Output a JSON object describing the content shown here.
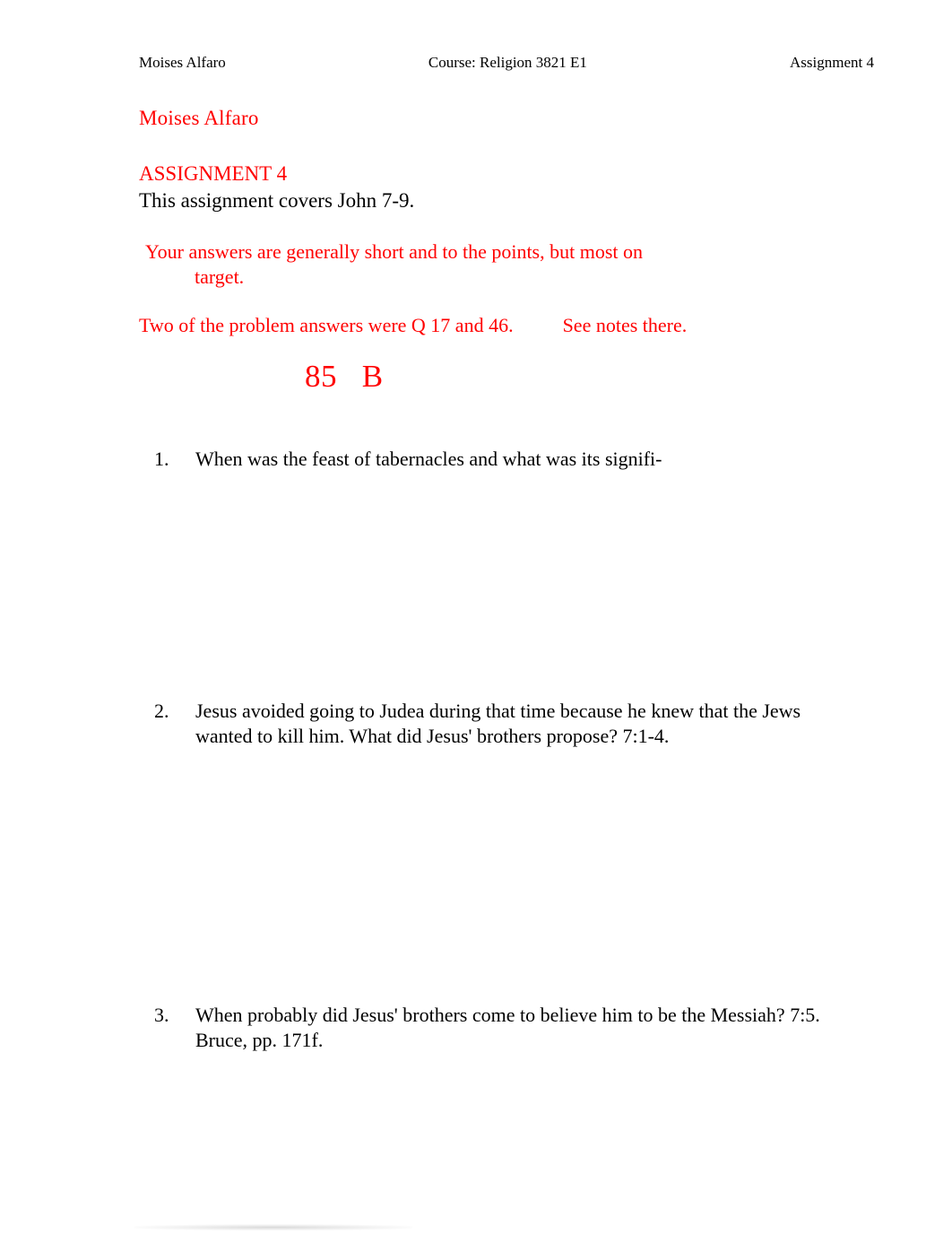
{
  "header": {
    "left": "Moises Alfaro",
    "center": "Course: Religion 3821 E1",
    "right": "Assignment 4"
  },
  "document": {
    "student_name": "Moises Alfaro",
    "assignment_title": "ASSIGNMENT 4",
    "assignment_subtitle": "This assignment covers John 7-9.",
    "feedback_line_1": " Your answers are generally short and to the points, but most on",
    "feedback_line_1_continued": "target.",
    "feedback_line_2": "Two of the problem answers were Q 17 and 46.          See notes there.",
    "grade": "85   B"
  },
  "colors": {
    "instructor_red": "#ff0000",
    "body_black": "#000000",
    "page_background": "#ffffff"
  },
  "questions": [
    {
      "number": "1.",
      "text": "When was the feast of tabernacles and what was its signifi-"
    },
    {
      "number": "2.",
      "text": "Jesus avoided going to Judea during that time because he knew that the Jews wanted to kill him. What did Jesus' brothers propose? 7:1-4."
    },
    {
      "number": "3.",
      "text": "When probably did Jesus' brothers come to believe him to be the Messiah? 7:5. Bruce, pp. 171f."
    }
  ]
}
